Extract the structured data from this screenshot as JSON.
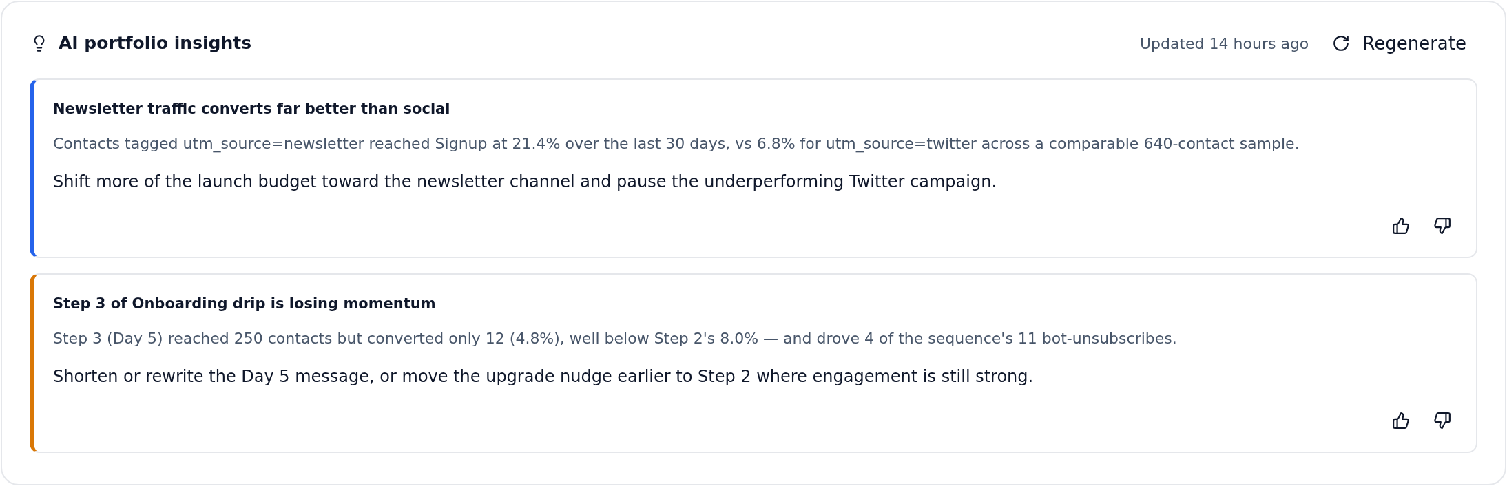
{
  "header": {
    "title": "AI portfolio insights",
    "updated": "Updated 14 hours ago",
    "regenerate_button": "Regenerate"
  },
  "insights": [
    {
      "title": "Newsletter traffic converts far better than social",
      "evidence": "Contacts tagged utm_source=newsletter reached Signup at 21.4% over the last 30 days, vs 6.8% for utm_source=twitter across a comparable 640-contact sample.",
      "recommendation": "Shift more of the launch budget toward the newsletter channel and pause the underperforming Twitter campaign.",
      "color": "#2563eb"
    },
    {
      "title": "Step 3 of Onboarding drip is losing momentum",
      "evidence": "Step 3 (Day 5) reached 250 contacts but converted only 12 (4.8%), well below Step 2's 8.0% — and drove 4 of the sequence's 11 bot-unsubscribes.",
      "recommendation": "Shorten or rewrite the Day 5 message, or move the upgrade nudge earlier to Step 2 where engagement is still strong.",
      "color": "#d97706"
    }
  ]
}
